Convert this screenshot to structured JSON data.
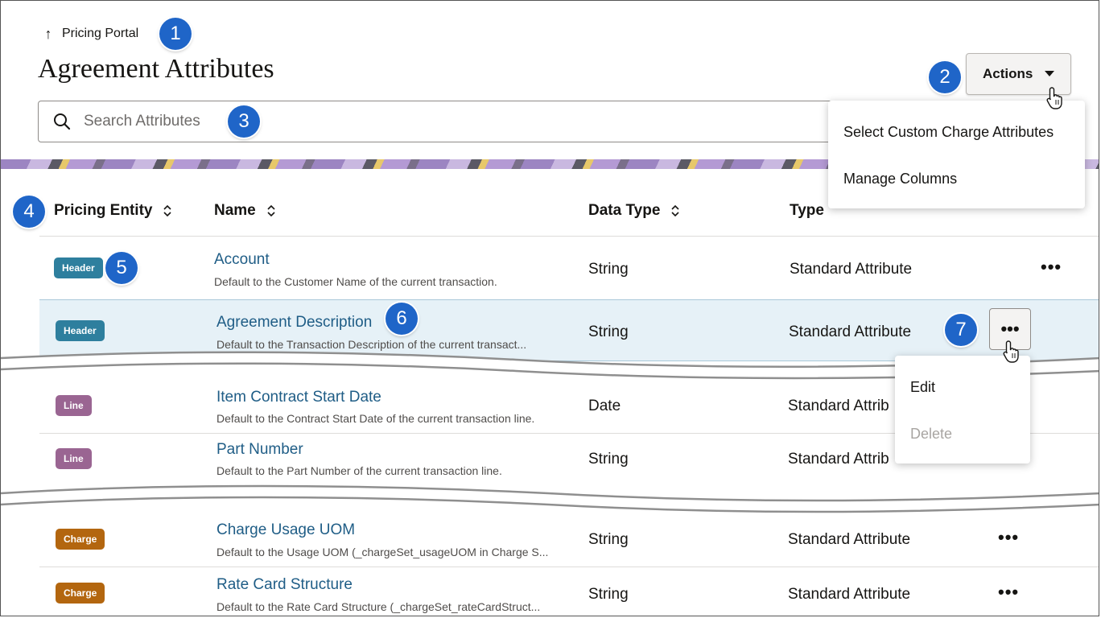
{
  "breadcrumb": {
    "label": "Pricing Portal"
  },
  "page": {
    "title": "Agreement Attributes"
  },
  "actions": {
    "label": "Actions"
  },
  "search": {
    "placeholder": "Search Attributes"
  },
  "actions_menu": {
    "items": [
      "Select Custom Charge Attributes",
      "Manage Columns"
    ]
  },
  "row_menu": {
    "items": [
      {
        "label": "Edit",
        "enabled": true
      },
      {
        "label": "Delete",
        "enabled": false
      }
    ]
  },
  "table": {
    "columns": [
      "Pricing Entity",
      "Name",
      "Data Type",
      "Type"
    ],
    "rows": [
      {
        "entity": "Header",
        "name": "Account",
        "description": "Default to the Customer Name of the current transaction.",
        "data_type": "String",
        "type": "Standard Attribute"
      },
      {
        "entity": "Header",
        "name": "Agreement Description",
        "description": "Default to the Transaction Description of the current transact...",
        "data_type": "String",
        "type": "Standard Attribute"
      },
      {
        "entity": "Line",
        "name": "Item Contract Start Date",
        "description": "Default to the Contract Start Date of the current transaction line.",
        "data_type": "Date",
        "type": "Standard Attrib"
      },
      {
        "entity": "Line",
        "name": "Part Number",
        "description": "Default to the Part Number of the current transaction line.",
        "data_type": "String",
        "type": "Standard Attrib"
      },
      {
        "entity": "Charge",
        "name": "Charge Usage UOM",
        "description": "Default to the Usage UOM (_chargeSet_usageUOM in Charge S...",
        "data_type": "String",
        "type": "Standard Attribute"
      },
      {
        "entity": "Charge",
        "name": "Rate Card Structure",
        "description": "Default to the Rate Card Structure (_chargeSet_rateCardStruct...",
        "data_type": "String",
        "type": "Standard Attribute"
      }
    ]
  },
  "callouts": [
    "1",
    "2",
    "3",
    "4",
    "5",
    "6",
    "7"
  ],
  "more_label": "•••",
  "colors": {
    "header_badge": "#2e7f9e",
    "line_badge": "#9a6592",
    "charge_badge": "#b3660f",
    "link": "#1f5d86",
    "callout": "#1f65c8",
    "selected_row": "#e6f1f7"
  },
  "icons": {
    "back": "arrow-up-icon",
    "search": "search-icon",
    "dropdown": "caret-down-icon",
    "sort": "sort-icon",
    "more": "more-icon",
    "cursor": "hand-pointer-icon"
  }
}
